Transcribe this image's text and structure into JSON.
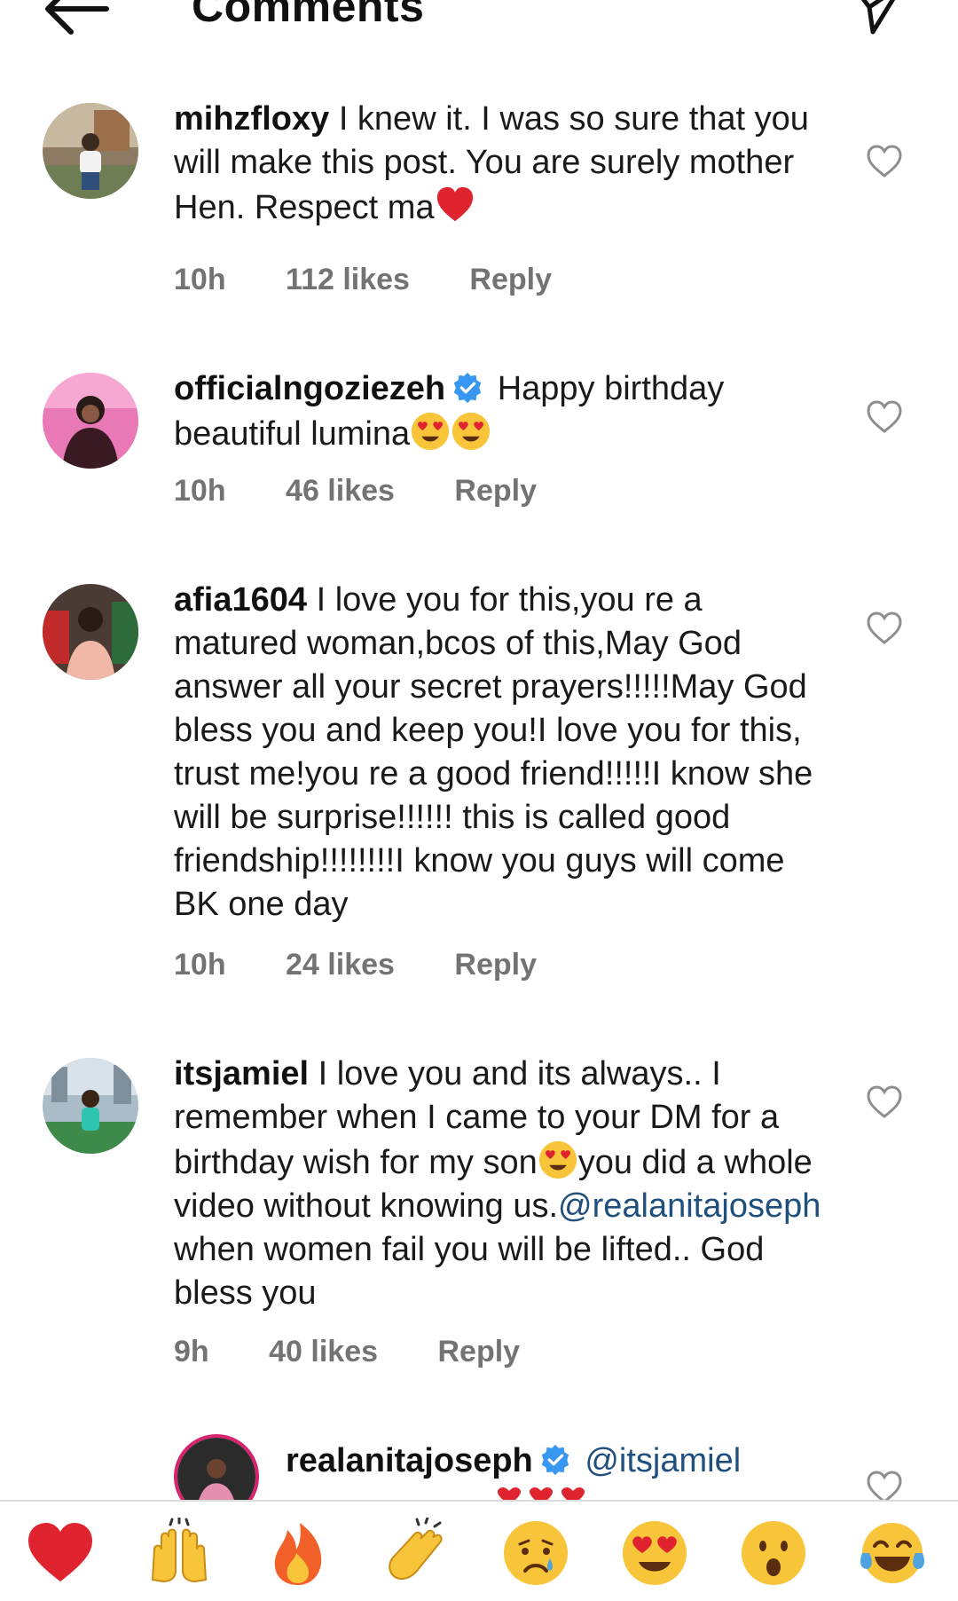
{
  "header": {
    "title": "Comments"
  },
  "comments": [
    {
      "username": "mihzfloxy",
      "text": "I knew it. I was so sure that you will make this post. You are surely mother Hen. Respect ma",
      "time": "10h",
      "likes": "112 likes",
      "reply": "Reply"
    },
    {
      "username": "officialngoziezeh",
      "text": "Happy birthday beautiful lumina",
      "time": "10h",
      "likes": "46 likes",
      "reply": "Reply"
    },
    {
      "username": "afia1604",
      "text": "I love you for this,you re a matured woman,bcos of this,May God answer all your secret prayers!!!!!May God bless you and keep you!I love you for this, trust me!you re a good friend!!!!!I know she will be surprise!!!!!! this is called good friendship!!!!!!!!I know you guys will come BK one day",
      "time": "10h",
      "likes": "24 likes",
      "reply": "Reply"
    },
    {
      "username": "itsjamiel",
      "text_before": "I love you and its always.. I remember when I came to your DM for a birthday wish for my son",
      "text_middle": "you did a whole video without knowing us.",
      "mention": "@realanitajoseph",
      "text_after": " when women fail you will be lifted.. God bless you",
      "time": "9h",
      "likes": "40 likes",
      "reply": "Reply"
    }
  ],
  "reply_comment": {
    "username": "realanitajoseph",
    "mention": "@itsjamiel"
  },
  "emoji_bar": [
    "red-heart",
    "raising-hands",
    "fire",
    "clapping-hands",
    "crying-face",
    "heart-eyes",
    "surprised-face",
    "tears-of-joy"
  ],
  "colors": {
    "verified": "#3897f0",
    "heart": "#e0242f",
    "meta": "#737373",
    "mention": "#1f4f7d"
  }
}
